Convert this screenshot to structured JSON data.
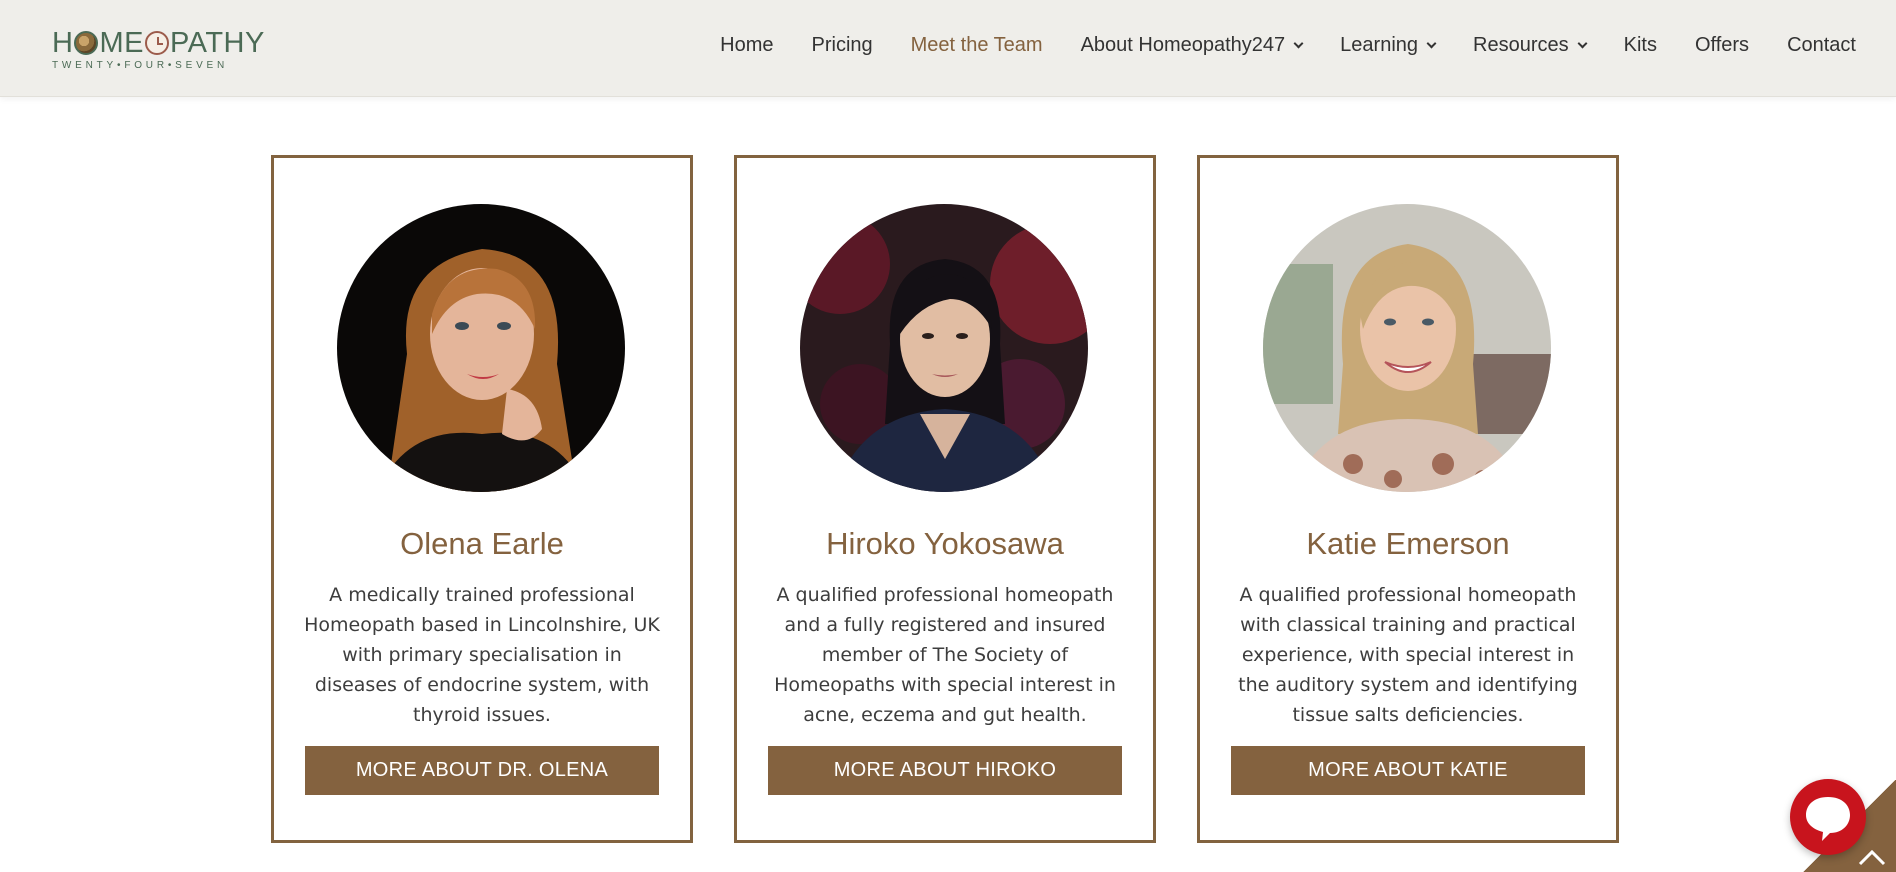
{
  "header": {
    "logo": {
      "word": "HOMEOPATHY",
      "tagline": "TWENTY•FOUR•SEVEN"
    },
    "nav": [
      {
        "label": "Home",
        "dropdown": false,
        "active": false
      },
      {
        "label": "Pricing",
        "dropdown": false,
        "active": false
      },
      {
        "label": "Meet the Team",
        "dropdown": false,
        "active": true
      },
      {
        "label": "About Homeopathy247",
        "dropdown": true,
        "active": false
      },
      {
        "label": "Learning",
        "dropdown": true,
        "active": false
      },
      {
        "label": "Resources",
        "dropdown": true,
        "active": false
      },
      {
        "label": "Kits",
        "dropdown": false,
        "active": false
      },
      {
        "label": "Offers",
        "dropdown": false,
        "active": false
      },
      {
        "label": "Contact",
        "dropdown": false,
        "active": false
      }
    ]
  },
  "team": [
    {
      "name": "Olena Earle",
      "bio": "A medically trained professional Homeopath based in Lincolnshire, UK with primary specialisation in diseases of endocrine system, with thyroid issues.",
      "button": "MORE ABOUT DR. OLENA"
    },
    {
      "name": "Hiroko Yokosawa",
      "bio": "A qualified professional homeopath and a fully registered and insured member of The Society of Homeopaths with special interest in acne, eczema and gut health.",
      "button": "MORE ABOUT HIROKO"
    },
    {
      "name": "Katie Emerson",
      "bio": "A qualified professional homeopath with classical training and practical experience, with special interest in the auditory system and identifying tissue salts deficiencies.",
      "button": "MORE ABOUT KATIE"
    }
  ],
  "colors": {
    "accent": "#84623f",
    "header_bg": "#efeeea",
    "logo_green": "#4b6a55",
    "chat_red": "#c8141d"
  },
  "icons": {
    "chat": "chat-bubble-icon",
    "scroll_top": "chevron-up-icon"
  }
}
